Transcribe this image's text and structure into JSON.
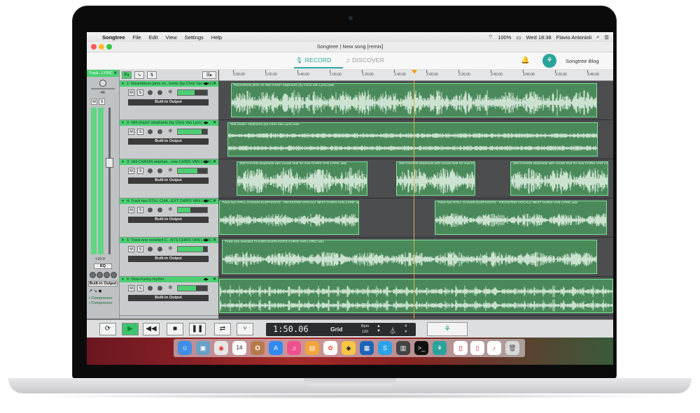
{
  "menubar": {
    "app": "Songtree",
    "items": [
      "File",
      "Edit",
      "View",
      "Settings",
      "Help"
    ],
    "battery": "100%",
    "clock": "Wed 18:38",
    "user": "Flavio Antonioli"
  },
  "window": {
    "title": "Songtree | New song [remix]"
  },
  "header": {
    "tabs": [
      {
        "label": "RECORD",
        "icon": "microphone-icon",
        "active": true
      },
      {
        "label": "DISCOVER",
        "icon": "music-note-icon",
        "active": false
      }
    ],
    "blog_label": "Songtree Blog"
  },
  "master": {
    "title": "Track...LYRIC",
    "gain_top": "-46",
    "gain_bottom": "+10.0",
    "eq_label": "EQ",
    "output_label": "Built-in Output",
    "plugins": [
      "Compressor",
      "Compressor"
    ]
  },
  "toolbar": {
    "fx_label": "Fx"
  },
  "tracks": [
    {
      "title": "1: Ravenblues jams on...hants (by Chris Van Lyric)",
      "output": "Built-in Output",
      "clip_name": "Ravenblues jams on Still chasin' elephants (by Chris Van Lyric).wav"
    },
    {
      "title": "2: Still chasin' elephants (by Chris Van Lyric)",
      "output": "Built-in Output",
      "clip_name": "Still chasin' elephants (by Chris Van Lyric).wav"
    },
    {
      "title": "3: Still CHASIN elephan...now CHRIS VAN LYRIC",
      "output": "Built-in Output",
      "clip_name": "Still CHASIN elephants with vocals final for now CHRIS VAN LYRIC.wav"
    },
    {
      "title": "4: Track two STILL CHA...EXT CHRIS VAN LYRIC",
      "output": "Built-in Output",
      "clip_name": "Track two STILL CHASIN ELEPHANTS - REVISITED VOCALS NEXT CHRIS VAN LYRIC.wav"
    },
    {
      "title": "5: Track one revisited C...NTS CHRIS VAN LYRIC",
      "output": "Built-in Output",
      "clip_name": "Track one revisited CHASIN ELEPHANTS CHRIS VAN LYRIC.wav"
    },
    {
      "title": "6: Slow-Funky-rhythm",
      "output": "Built-in Output",
      "clip_name": ""
    }
  ],
  "ruler": [
    "0:00.00",
    "0:20.00",
    "0:40.00",
    "1:00.00",
    "1:20.00",
    "1:40.00",
    "2:00.00",
    "2:20.00",
    "2:40.00",
    "3:00.00",
    "3:20.00",
    "3:40.00"
  ],
  "transport": {
    "time": "1:50.06",
    "grid": "Grid",
    "bpm_label": "Bpm",
    "bpm": "120",
    "sig_top": "4",
    "sig_bottom": "4"
  },
  "dock": {
    "calendar_day": "14",
    "items": [
      "finder-icon",
      "preview-icon",
      "chrome-icon",
      "calendar-icon",
      "firefox-icon",
      "appstore-icon",
      "itunes-icon",
      "ibooks-icon",
      "photos-icon",
      "sketch-icon",
      "virtualbox-icon",
      "skype-icon",
      "daw-icon",
      "terminal-icon",
      "songtree-icon",
      "trash-icon"
    ]
  },
  "colors": {
    "accent": "#2aa49a",
    "track_green": "#4ccf73",
    "clip_green": "#4a8a5a"
  }
}
